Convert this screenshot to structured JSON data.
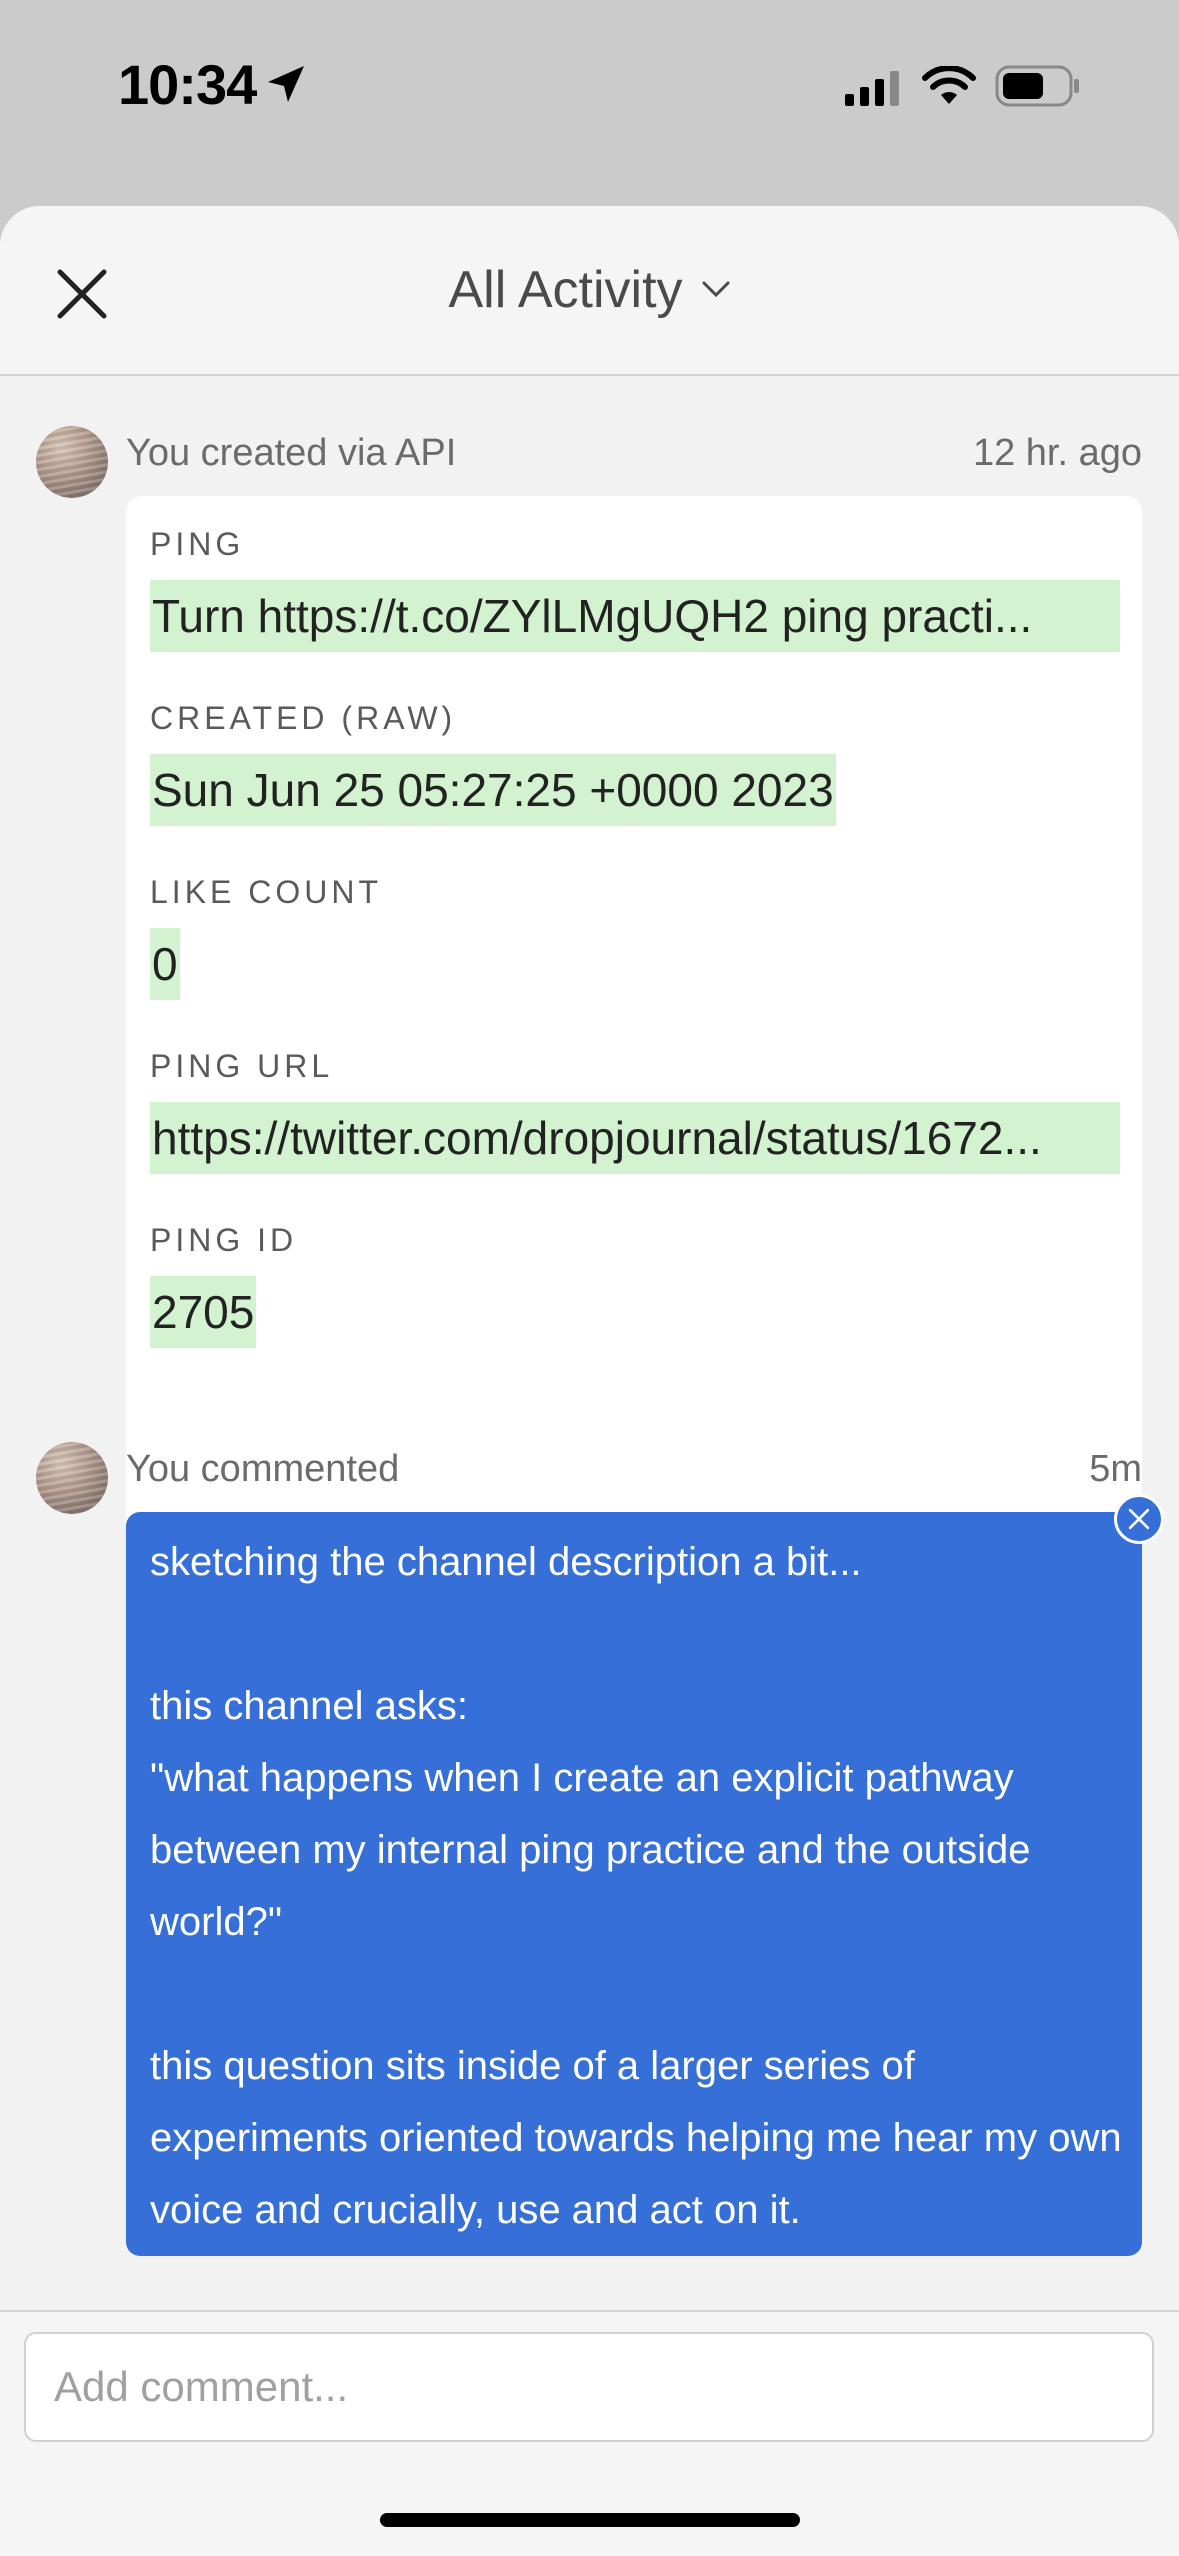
{
  "status_bar": {
    "time": "10:34"
  },
  "header": {
    "title": "All Activity"
  },
  "activities": [
    {
      "meta": "You created via API",
      "ago": "12 hr. ago",
      "fields": [
        {
          "label": "PING",
          "value": "Turn https://t.co/ZYlLMgUQH2 ping practi..."
        },
        {
          "label": "CREATED (RAW)",
          "value": "Sun Jun 25 05:27:25 +0000 2023"
        },
        {
          "label": "LIKE COUNT",
          "value": "0"
        },
        {
          "label": "PING URL",
          "value": "https://twitter.com/dropjournal/status/1672..."
        },
        {
          "label": "PING ID",
          "value": "2705"
        }
      ]
    },
    {
      "meta": "You commented",
      "ago": "5m",
      "comment": "sketching the channel description a bit...\n\nthis channel asks:\n\"what happens when I create an explicit pathway between my internal ping practice and the outside world?\"\n\nthis question sits inside of a larger series of experiments oriented towards helping me hear my own voice and crucially, use and act on it."
    }
  ],
  "composer": {
    "placeholder": "Add comment..."
  },
  "colors": {
    "comment_bg": "#356fd7",
    "field_highlight": "#d3f2d0"
  }
}
